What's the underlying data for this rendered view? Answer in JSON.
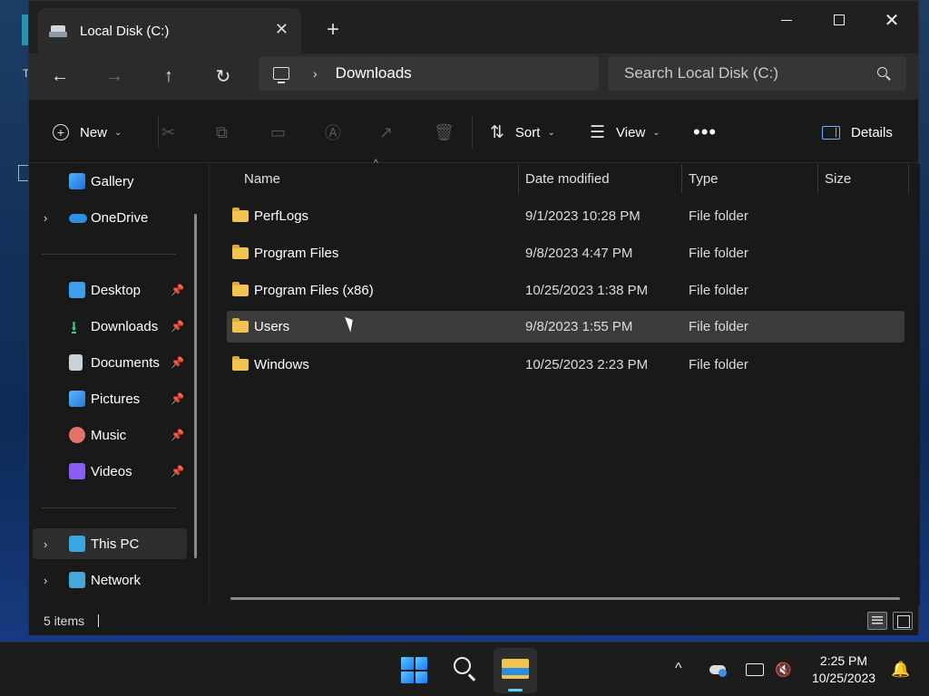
{
  "window": {
    "tab_title": "Local Disk (C:)",
    "new_tab": "+",
    "close_tab": "✕"
  },
  "address": {
    "breadcrumb_sep": "›",
    "current": "Downloads",
    "search_placeholder": "Search Local Disk (C:)"
  },
  "commands": {
    "new": "New",
    "sort": "Sort",
    "view": "View",
    "more": "•••",
    "details": "Details"
  },
  "sidebar": {
    "items": [
      {
        "label": "Gallery",
        "icon": "gallery-icon"
      },
      {
        "label": "OneDrive",
        "icon": "onedrive-icon"
      },
      {
        "label": "Desktop",
        "icon": "desktop-icon"
      },
      {
        "label": "Downloads",
        "icon": "downloads-icon"
      },
      {
        "label": "Documents",
        "icon": "documents-icon"
      },
      {
        "label": "Pictures",
        "icon": "pictures-icon"
      },
      {
        "label": "Music",
        "icon": "music-icon"
      },
      {
        "label": "Videos",
        "icon": "videos-icon"
      },
      {
        "label": "This PC",
        "icon": "this-pc-icon"
      },
      {
        "label": "Network",
        "icon": "network-icon"
      }
    ]
  },
  "columns": {
    "name": "Name",
    "date": "Date modified",
    "type": "Type",
    "size": "Size"
  },
  "files": [
    {
      "name": "PerfLogs",
      "date": "9/1/2023 10:28 PM",
      "type": "File folder"
    },
    {
      "name": "Program Files",
      "date": "9/8/2023 4:47 PM",
      "type": "File folder"
    },
    {
      "name": "Program Files (x86)",
      "date": "10/25/2023 1:38 PM",
      "type": "File folder"
    },
    {
      "name": "Users",
      "date": "9/8/2023 1:55 PM",
      "type": "File folder"
    },
    {
      "name": "Windows",
      "date": "10/25/2023 2:23 PM",
      "type": "File folder"
    }
  ],
  "status": {
    "count": "5 items"
  },
  "taskbar": {
    "time": "2:25 PM",
    "date": "10/25/2023"
  },
  "desktop": {
    "fragment": "T"
  }
}
